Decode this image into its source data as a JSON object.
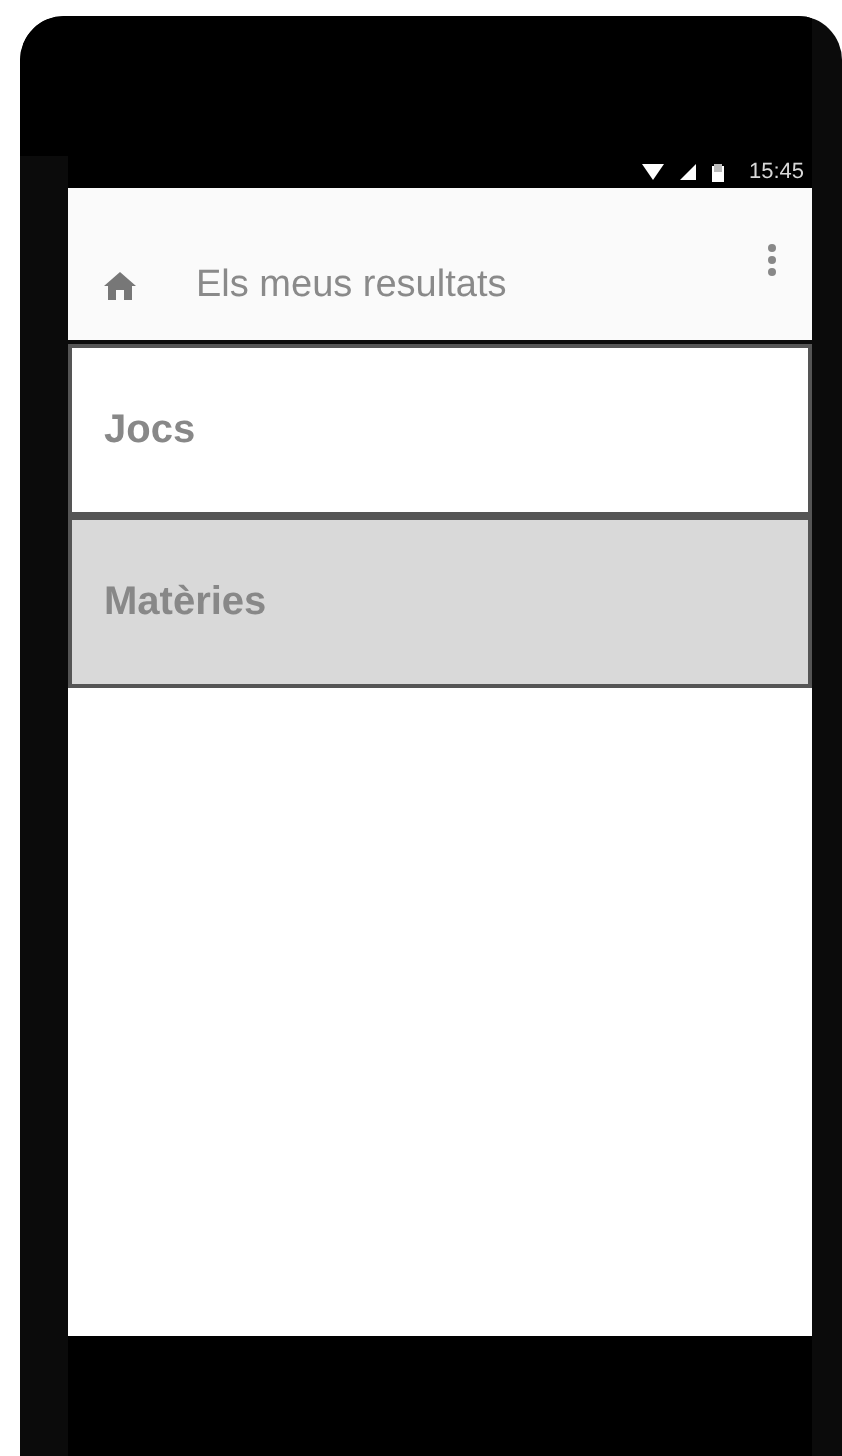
{
  "status_bar": {
    "time": "15:45"
  },
  "app_bar": {
    "title": "Els meus resultats"
  },
  "items": [
    {
      "label": "Jocs",
      "selected": false
    },
    {
      "label": "Matèries",
      "selected": true
    }
  ]
}
